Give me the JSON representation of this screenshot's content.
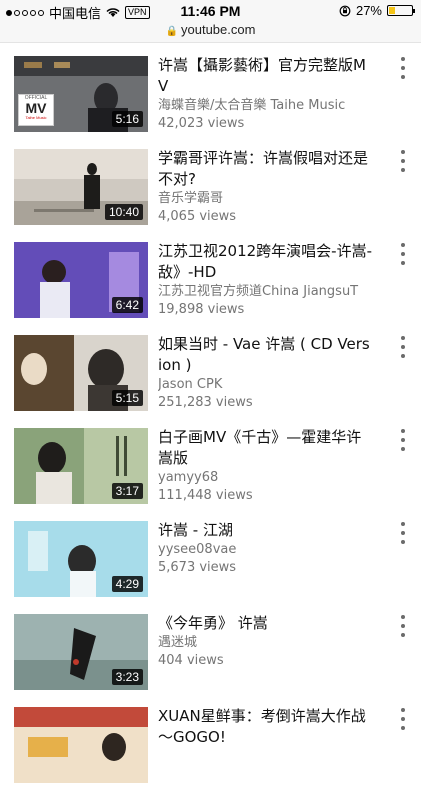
{
  "status_bar": {
    "carrier": "中国电信",
    "vpn": "VPN",
    "time": "11:46 PM",
    "battery": "27%",
    "battery_level": 0.27
  },
  "url_bar": {
    "url": "youtube.com"
  },
  "videos": [
    {
      "title": "许嵩【攝影藝術】官方完整版MV",
      "channel": "海蝶音樂/太合音樂 Taihe Music",
      "views": "42,023 views",
      "duration": "5:16",
      "badge": {
        "top": "OFFICIAL",
        "mid": "MV",
        "bottom": "Taihe Music"
      }
    },
    {
      "title": "学霸哥评许嵩：许嵩假唱对还是不对?",
      "channel": "音乐学霸哥",
      "views": "4,065 views",
      "duration": "10:40"
    },
    {
      "title": "江苏卫视2012跨年演唱会-许嵩-敌》-HD",
      "channel": "江苏卫视官方频道China JiangsuT",
      "views": "19,898 views",
      "duration": "6:42"
    },
    {
      "title": "如果当时 - Vae 许嵩 ( CD Version )",
      "channel": "Jason CPK",
      "views": "251,283 views",
      "duration": "5:15"
    },
    {
      "title": "白子画MV《千古》—霍建华许嵩版",
      "channel": "yamyy68",
      "views": "111,448 views",
      "duration": "3:17"
    },
    {
      "title": "许嵩 - 江湖",
      "channel": "yysee08vae",
      "views": "5,673 views",
      "duration": "4:29"
    },
    {
      "title": "《今年勇》 许嵩",
      "channel": "遇迷城",
      "views": "404 views",
      "duration": "3:23"
    },
    {
      "title": "XUAN星鲜事：考倒许嵩大作战～GOGO!",
      "channel": "",
      "views": "",
      "duration": ""
    }
  ],
  "colors": {
    "meta_text": "#757575",
    "duration_bg": "#000000",
    "battery": "#f5c518"
  }
}
